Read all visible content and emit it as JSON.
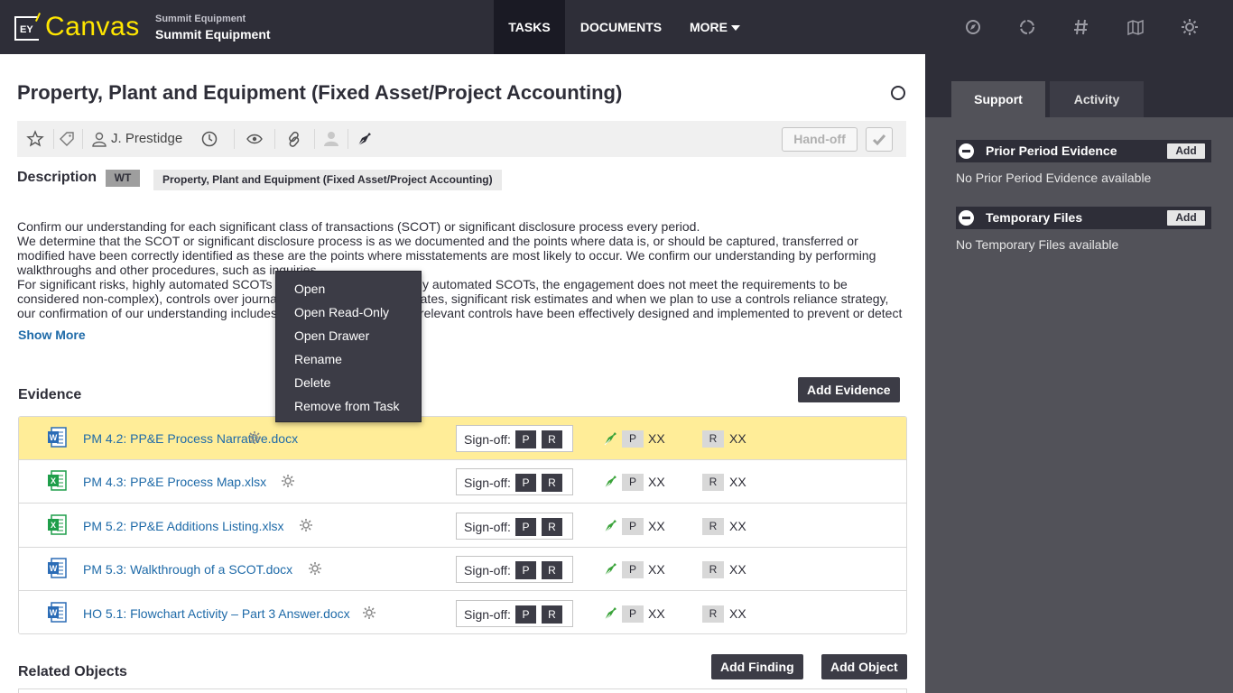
{
  "header": {
    "app_name": "Canvas",
    "logo_text": "EY",
    "client_sub": "Summit Equipment",
    "client_main": "Summit Equipment",
    "nav": {
      "tasks": "TASKS",
      "documents": "DOCUMENTS",
      "more": "MORE"
    },
    "icons": [
      "compass-icon",
      "sync-icon",
      "hash-icon",
      "map-icon",
      "settings-icon"
    ]
  },
  "task": {
    "title": "Property, Plant and Equipment (Fixed Asset/Project Accounting)",
    "assignee": "J. Prestidge",
    "handoff_label": "Hand-off"
  },
  "description": {
    "label": "Description",
    "badge": "WT",
    "chip": "Property, Plant and Equipment (Fixed Asset/Project Accounting)",
    "text": [
      "Confirm our understanding for each significant class of transactions (SCOT) or significant disclosure process every period.",
      "We determine that the SCOT or significant disclosure process is as we documented and the points where data is, or should be captured, transferred or modified have been correctly identified as these are the points where misstatements are most likely to occur. We confirm our understanding by performing walkthroughs and other procedures, such as inquiries.",
      "For significant risks, highly automated SCOTs (except for lower risk highly automated SCOTs, the engagement does not meet the requirements to be considered non-complex), controls over journal entries, higher risk estimates, significant risk estimates and when we plan to use a controls reliance strategy, our confirmation of our understanding includes determining whether the relevant controls have been effectively designed and implemented to prevent or detect and"
    ],
    "show_more": "Show More"
  },
  "evidence": {
    "title": "Evidence",
    "add_button": "Add Evidence",
    "signoff_label": "Sign-off:",
    "p_label": "P",
    "r_label": "R",
    "rows": [
      {
        "name": "PM 4.2: PP&E Process Narrative.docx",
        "type": "word",
        "p_user": "XX",
        "r_user": "XX",
        "highlighted": true
      },
      {
        "name": "PM 4.3: PP&E Process Map.xlsx",
        "type": "excel",
        "p_user": "XX",
        "r_user": "XX",
        "highlighted": false
      },
      {
        "name": "PM 5.2: PP&E Additions Listing.xlsx",
        "type": "excel",
        "p_user": "XX",
        "r_user": "XX",
        "highlighted": false
      },
      {
        "name": "PM 5.3: Walkthrough of a SCOT.docx",
        "type": "word",
        "p_user": "XX",
        "r_user": "XX",
        "highlighted": false
      },
      {
        "name": "HO 5.1: Flowchart Activity – Part 3 Answer.docx",
        "type": "word",
        "p_user": "XX",
        "r_user": "XX",
        "highlighted": false
      }
    ]
  },
  "related": {
    "title": "Related Objects",
    "add_finding": "Add Finding",
    "add_object": "Add Object"
  },
  "context_menu": {
    "items": [
      "Open",
      "Open Read-Only",
      "Open Drawer",
      "Rename",
      "Delete",
      "Remove from Task"
    ]
  },
  "right_panel": {
    "tabs": {
      "support": "Support",
      "activity": "Activity"
    },
    "sections": [
      {
        "title": "Prior Period Evidence",
        "add": "Add",
        "empty": "No Prior Period Evidence available"
      },
      {
        "title": "Temporary Files",
        "add": "Add",
        "empty": "No Temporary Files available"
      }
    ]
  },
  "colors": {
    "brand_yellow": "#ffe600",
    "dark": "#2e2e38",
    "link_blue": "#1e6aa8",
    "highlight_row": "#ffed98",
    "panel_gray": "#525259",
    "word_blue": "#2b6cb6",
    "excel_green": "#1f9e4a"
  }
}
